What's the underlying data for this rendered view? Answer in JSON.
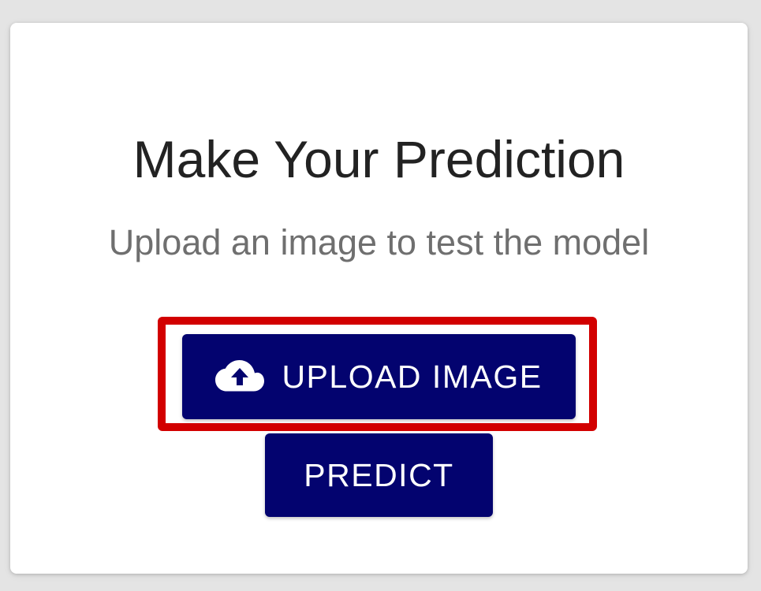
{
  "card": {
    "title": "Make Your Prediction",
    "subtitle": "Upload an image to test the model"
  },
  "actions": {
    "upload_label": "UPLOAD IMAGE",
    "upload_icon": "cloud-upload-icon",
    "predict_label": "PREDICT"
  },
  "colors": {
    "button_bg": "#03036f",
    "highlight": "#d20000",
    "title": "#222222",
    "subtitle": "#6f6f6f"
  }
}
